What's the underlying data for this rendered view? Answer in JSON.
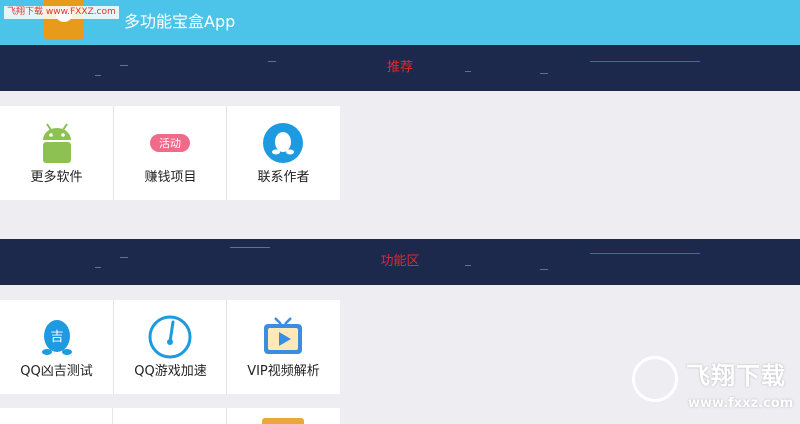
{
  "header": {
    "app_title": "多功能宝盒App",
    "site_tag": "飞翔下载 www.FXXZ.com",
    "logo_icon": "app-logo-icon",
    "background": "#4cc3e8"
  },
  "sections": [
    {
      "banner_label": "推荐",
      "items": [
        {
          "label": "更多软件",
          "icon": "android-icon"
        },
        {
          "label": "赚钱项目",
          "icon": "activity-tag-icon",
          "icon_text": "活动"
        },
        {
          "label": "联系作者",
          "icon": "penguin-icon"
        }
      ]
    },
    {
      "banner_label": "功能区",
      "items": [
        {
          "label": "QQ凶吉测试",
          "icon": "qq-fortune-icon",
          "icon_text": "吉"
        },
        {
          "label": "QQ游戏加速",
          "icon": "speedometer-icon"
        },
        {
          "label": "VIP视频解析",
          "icon": "tv-play-icon"
        }
      ]
    }
  ],
  "watermark": {
    "text": "飞翔下载",
    "url": "www.fxxz.com"
  },
  "colors": {
    "banner_bg": "#1d284d",
    "banner_text": "#e12a2a",
    "page_bg": "#eeeef2",
    "accent_blue": "#1e9ae0",
    "android_green": "#8dc152",
    "activity_pink": "#f06a8a"
  }
}
